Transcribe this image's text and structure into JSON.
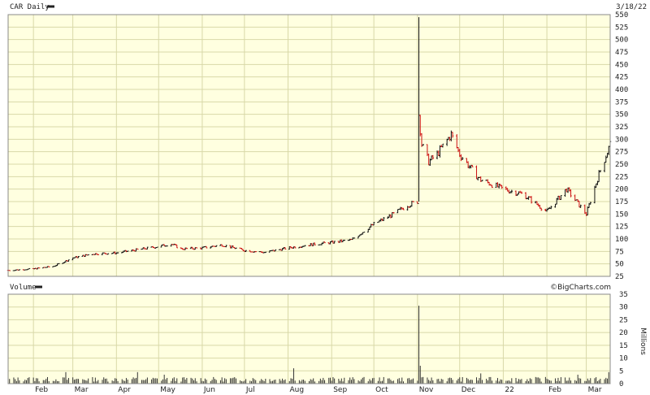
{
  "header": {
    "ticker_label": "CAR Daily",
    "date_label": "3/18/22"
  },
  "volume_header": {
    "label": "Volume",
    "brand": "©BigCharts.com"
  },
  "colors": {
    "background": "#ffffe0",
    "grid": "#d8d8a8",
    "up_bar": "#111111",
    "down_bar": "#cc1111",
    "volume_bar": "#333333",
    "frame": "#888888"
  },
  "chart_data": [
    {
      "type": "line",
      "name": "CAR Daily price (OHLC bars)",
      "y_scale": "linear",
      "ylim": [
        25,
        550
      ],
      "yticks": [
        25,
        50,
        75,
        100,
        125,
        150,
        175,
        200,
        225,
        250,
        275,
        300,
        325,
        350,
        375,
        400,
        425,
        450,
        475,
        500,
        525,
        550
      ],
      "x_ticks": [
        "Feb",
        "Mar",
        "Apr",
        "May",
        "Jun",
        "Jul",
        "Aug",
        "Sep",
        "Oct",
        "Nov",
        "Dec",
        "22",
        "Feb",
        "Mar"
      ],
      "grid": true,
      "x_range": [
        "2021-01-14",
        "2022-03-18"
      ],
      "series": [
        {
          "x": [
            "2021-01-15",
            "2021-02-01",
            "2021-02-15",
            "2021-03-01",
            "2021-03-15",
            "2021-04-01",
            "2021-04-15",
            "2021-05-01",
            "2021-05-10",
            "2021-05-17",
            "2021-06-01",
            "2021-06-15",
            "2021-07-01",
            "2021-07-15",
            "2021-08-01",
            "2021-08-15",
            "2021-09-01",
            "2021-09-15",
            "2021-10-01",
            "2021-10-15",
            "2021-10-25",
            "2021-11-01",
            "2021-11-02",
            "2021-11-04",
            "2021-11-09",
            "2021-11-15",
            "2021-11-25",
            "2021-12-01",
            "2021-12-15",
            "2022-01-01",
            "2022-01-15",
            "2022-02-01",
            "2022-02-15",
            "2022-03-01",
            "2022-03-10",
            "2022-03-18"
          ],
          "values": [
            37,
            40,
            45,
            62,
            70,
            72,
            78,
            85,
            90,
            80,
            82,
            88,
            77,
            73,
            82,
            88,
            93,
            98,
            130,
            150,
            168,
            175,
            350,
            290,
            255,
            270,
            310,
            270,
            220,
            200,
            190,
            155,
            200,
            150,
            230,
            290
          ]
        }
      ]
    },
    {
      "type": "bar",
      "name": "Volume",
      "ylabel": "Millions",
      "ylim": [
        0,
        35
      ],
      "yticks": [
        0,
        5,
        10,
        15,
        20,
        25,
        30,
        35
      ],
      "grid": true,
      "x_ticks": [
        "Feb",
        "Mar",
        "Apr",
        "May",
        "Jun",
        "Jul",
        "Aug",
        "Sep",
        "Oct",
        "Nov",
        "Dec",
        "22",
        "Feb",
        "Mar"
      ],
      "series": [
        {
          "x": [
            "2021-01-29",
            "2021-02-24",
            "2021-04-16",
            "2021-05-05",
            "2021-08-05",
            "2021-11-02",
            "2021-11-03",
            "2021-12-16",
            "2022-02-23",
            "2022-03-17"
          ],
          "values": [
            2.5,
            4.5,
            4.5,
            3.5,
            6.0,
            30.5,
            7.0,
            4.0,
            3.5,
            4.5
          ]
        }
      ]
    }
  ]
}
